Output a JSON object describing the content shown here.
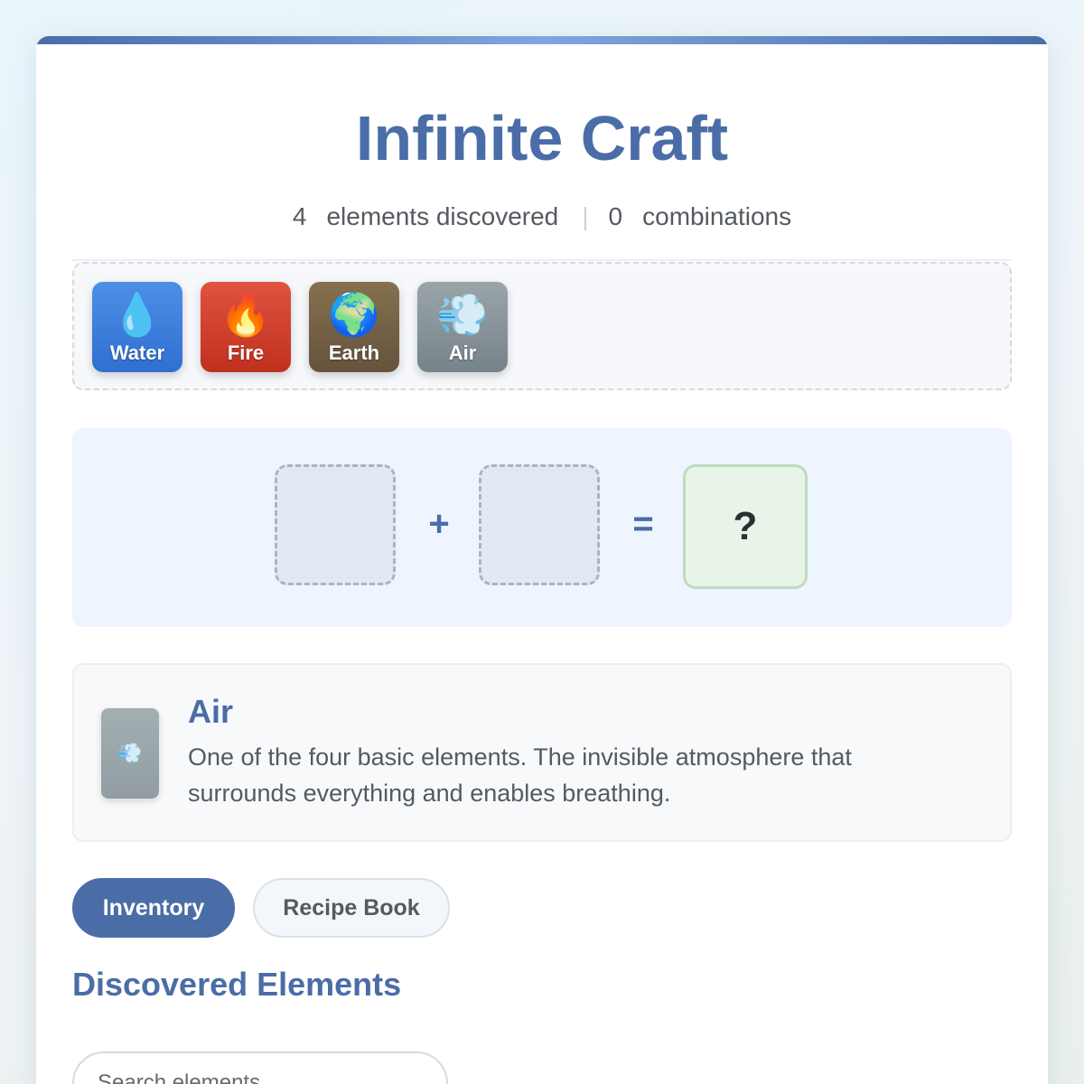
{
  "app": {
    "title": "Infinite Craft"
  },
  "stats": {
    "elements_count": "4",
    "elements_label": "elements discovered",
    "separator": "|",
    "combinations_count": "0",
    "combinations_label": "combinations"
  },
  "tray": {
    "elements": [
      {
        "name": "Water",
        "icon": "💧",
        "icon_name": "water-drop-icon",
        "color": "#2f6fd1"
      },
      {
        "name": "Fire",
        "icon": "🔥",
        "icon_name": "flame-icon",
        "color": "#c8362a"
      },
      {
        "name": "Earth",
        "icon": "🌍",
        "icon_name": "globe-icon",
        "color": "#6e5b43"
      },
      {
        "name": "Air",
        "icon": "💨",
        "icon_name": "wind-icon",
        "color": "#7b878c"
      }
    ]
  },
  "workspace": {
    "plus": "+",
    "equals": "=",
    "result_placeholder": "?"
  },
  "info": {
    "icon": "💨",
    "name": "Air",
    "description": "One of the four basic elements. The invisible atmosphere that surrounds everything and enables breathing."
  },
  "tabs": {
    "inventory": "Inventory",
    "recipe_book": "Recipe Book"
  },
  "section": {
    "title": "Discovered Elements"
  },
  "search": {
    "placeholder": "Search elements..."
  },
  "colors": {
    "accent": "#4a6da7",
    "text": "#555a60"
  }
}
